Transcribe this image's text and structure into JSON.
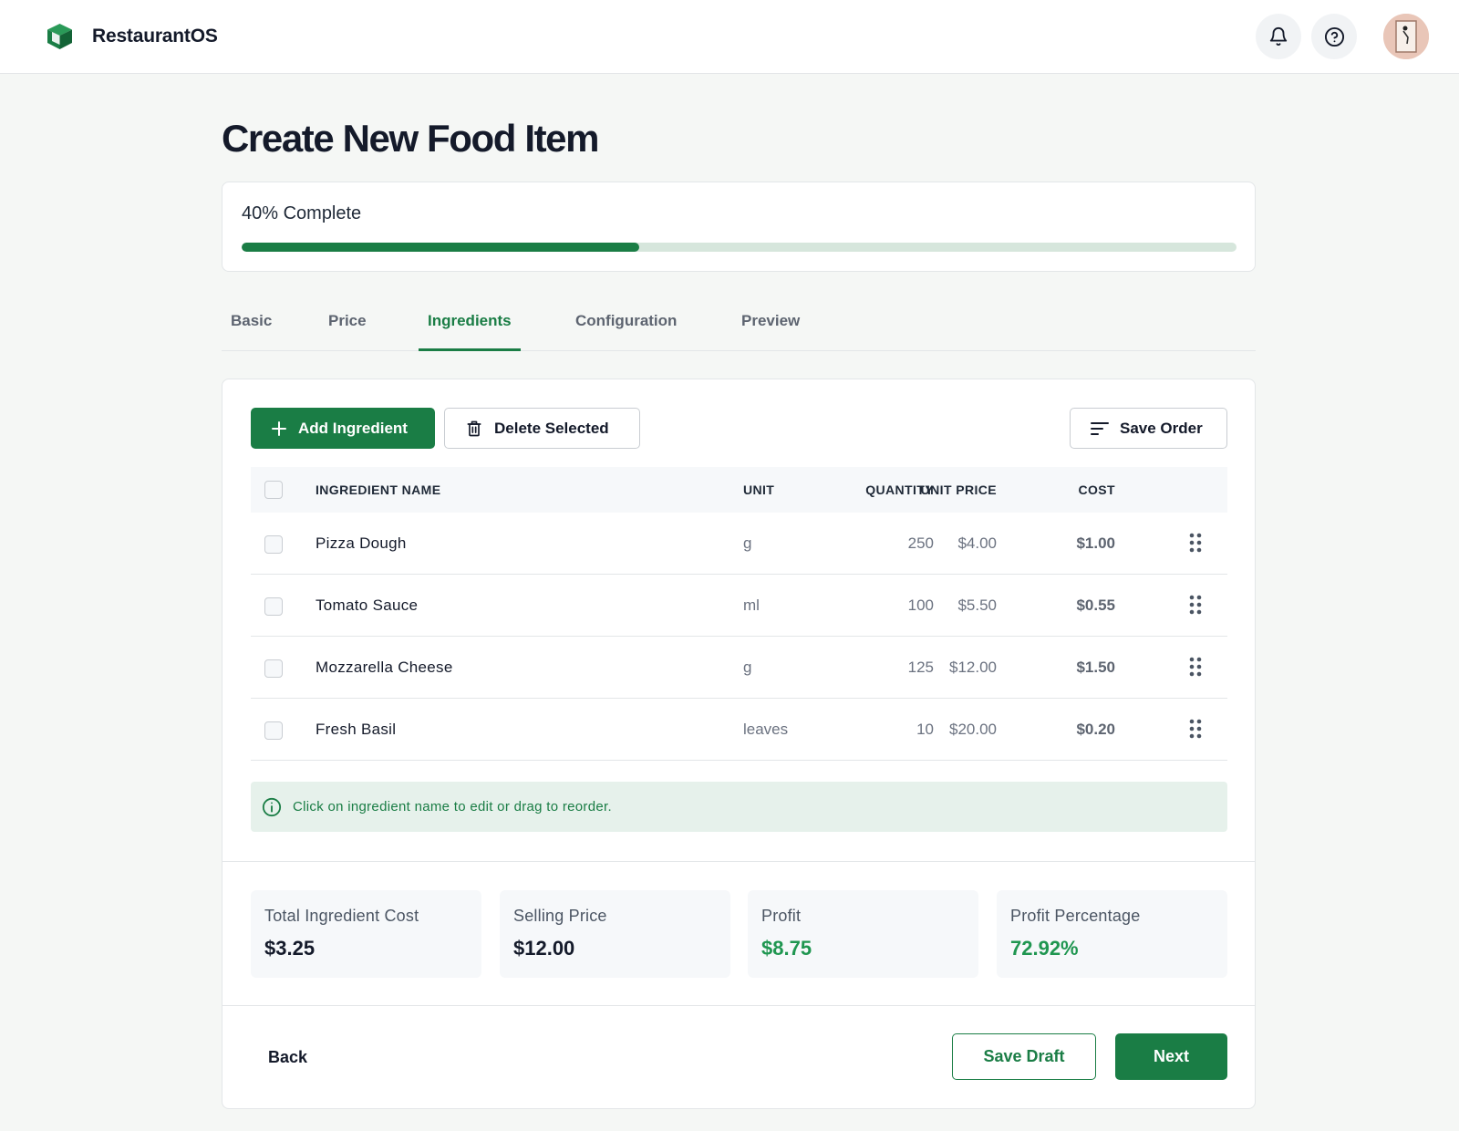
{
  "app": {
    "name": "RestaurantOS"
  },
  "header": {
    "notifications_icon": "bell-icon",
    "help_icon": "help-circle-icon"
  },
  "page": {
    "title": "Create New Food Item"
  },
  "progress": {
    "label": "40% Complete",
    "percent": 40
  },
  "tabs": [
    {
      "label": "Basic",
      "active": false
    },
    {
      "label": "Price",
      "active": false
    },
    {
      "label": "Ingredients",
      "active": true
    },
    {
      "label": "Configuration",
      "active": false
    },
    {
      "label": "Preview",
      "active": false
    }
  ],
  "toolbar": {
    "add_label": "Add Ingredient",
    "delete_label": "Delete Selected",
    "save_order_label": "Save Order"
  },
  "table": {
    "headers": {
      "name": "INGREDIENT NAME",
      "quantity": "QUANTITY",
      "unit": "UNIT",
      "unit_price": "UNIT PRICE",
      "cost": "COST"
    },
    "rows": [
      {
        "name": "Pizza Dough",
        "quantity": "250",
        "unit": "g",
        "unit_price": "$4.00",
        "cost": "$1.00"
      },
      {
        "name": "Tomato Sauce",
        "quantity": "100",
        "unit": "ml",
        "unit_price": "$5.50",
        "cost": "$0.55"
      },
      {
        "name": "Mozzarella Cheese",
        "quantity": "125",
        "unit": "g",
        "unit_price": "$12.00",
        "cost": "$1.50"
      },
      {
        "name": "Fresh Basil",
        "quantity": "10",
        "unit": "leaves",
        "unit_price": "$20.00",
        "cost": "$0.20"
      }
    ]
  },
  "info": {
    "text": "Click on ingredient name to edit or drag to reorder."
  },
  "summary": [
    {
      "label": "Total Ingredient Cost",
      "value": "$3.25",
      "highlight": false
    },
    {
      "label": "Selling Price",
      "value": "$12.00",
      "highlight": false
    },
    {
      "label": "Profit",
      "value": "$8.75",
      "highlight": true
    },
    {
      "label": "Profit Percentage",
      "value": "72.92%",
      "highlight": true
    }
  ],
  "footer": {
    "back_label": "Back",
    "save_draft_label": "Save Draft",
    "next_label": "Next"
  },
  "colors": {
    "brand": "#1a7d45",
    "profit": "#1f9650",
    "info_bg": "#e6f1eb"
  }
}
